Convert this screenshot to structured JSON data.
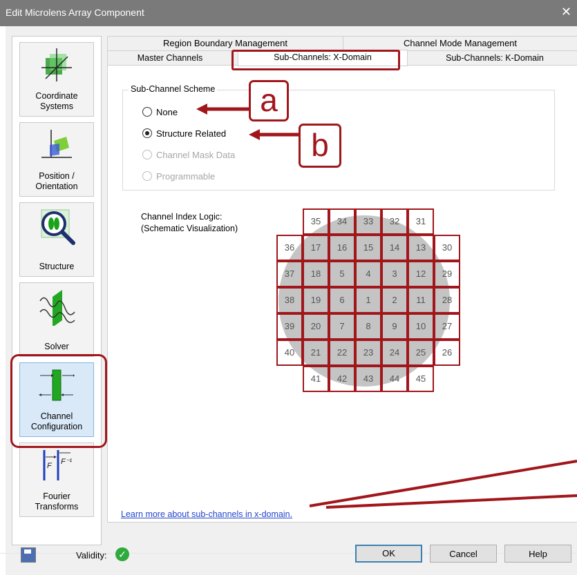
{
  "window": {
    "title": "Edit Microlens Array Component",
    "close": "✕"
  },
  "sidebar": {
    "items": [
      {
        "label1": "Coordinate",
        "label2": "Systems"
      },
      {
        "label1": "Position /",
        "label2": "Orientation"
      },
      {
        "label1": "",
        "label2": "Structure"
      },
      {
        "label1": "",
        "label2": "Solver"
      },
      {
        "label1": "Channel",
        "label2": "Configuration"
      },
      {
        "label1": "Fourier",
        "label2": "Transforms"
      }
    ]
  },
  "tabs": {
    "row1": [
      "Region Boundary Management",
      "Channel Mode Management"
    ],
    "row2": [
      "Master Channels",
      "Sub-Channels: X-Domain",
      "Sub-Channels: K-Domain"
    ],
    "selected": "Sub-Channels: X-Domain"
  },
  "scheme": {
    "title": "Sub-Channel Scheme",
    "options": [
      "None",
      "Structure Related",
      "Channel Mask Data",
      "Programmable"
    ],
    "selected": "Structure Related"
  },
  "channel_logic": {
    "line1": "Channel Index Logic:",
    "line2": "(Schematic Visualization)",
    "rows": [
      [
        "",
        "35",
        "34",
        "33",
        "32",
        "31",
        ""
      ],
      [
        "36",
        "17",
        "16",
        "15",
        "14",
        "13",
        "30"
      ],
      [
        "37",
        "18",
        "5",
        "4",
        "3",
        "12",
        "29"
      ],
      [
        "38",
        "19",
        "6",
        "1",
        "2",
        "11",
        "28"
      ],
      [
        "39",
        "20",
        "7",
        "8",
        "9",
        "10",
        "27"
      ],
      [
        "40",
        "21",
        "22",
        "23",
        "24",
        "25",
        "26"
      ],
      [
        "",
        "41",
        "42",
        "43",
        "44",
        "45",
        ""
      ]
    ]
  },
  "link": "Learn more about sub-channels in x-domain.",
  "footer": {
    "validity": "Validity:",
    "ok": "OK",
    "cancel": "Cancel",
    "help": "Help"
  },
  "annotations": {
    "a": "a",
    "b": "b"
  },
  "colors": {
    "highlight": "#a0161b",
    "title_bar": "#7a7a7a",
    "active_nav": "#d9e9f8"
  }
}
